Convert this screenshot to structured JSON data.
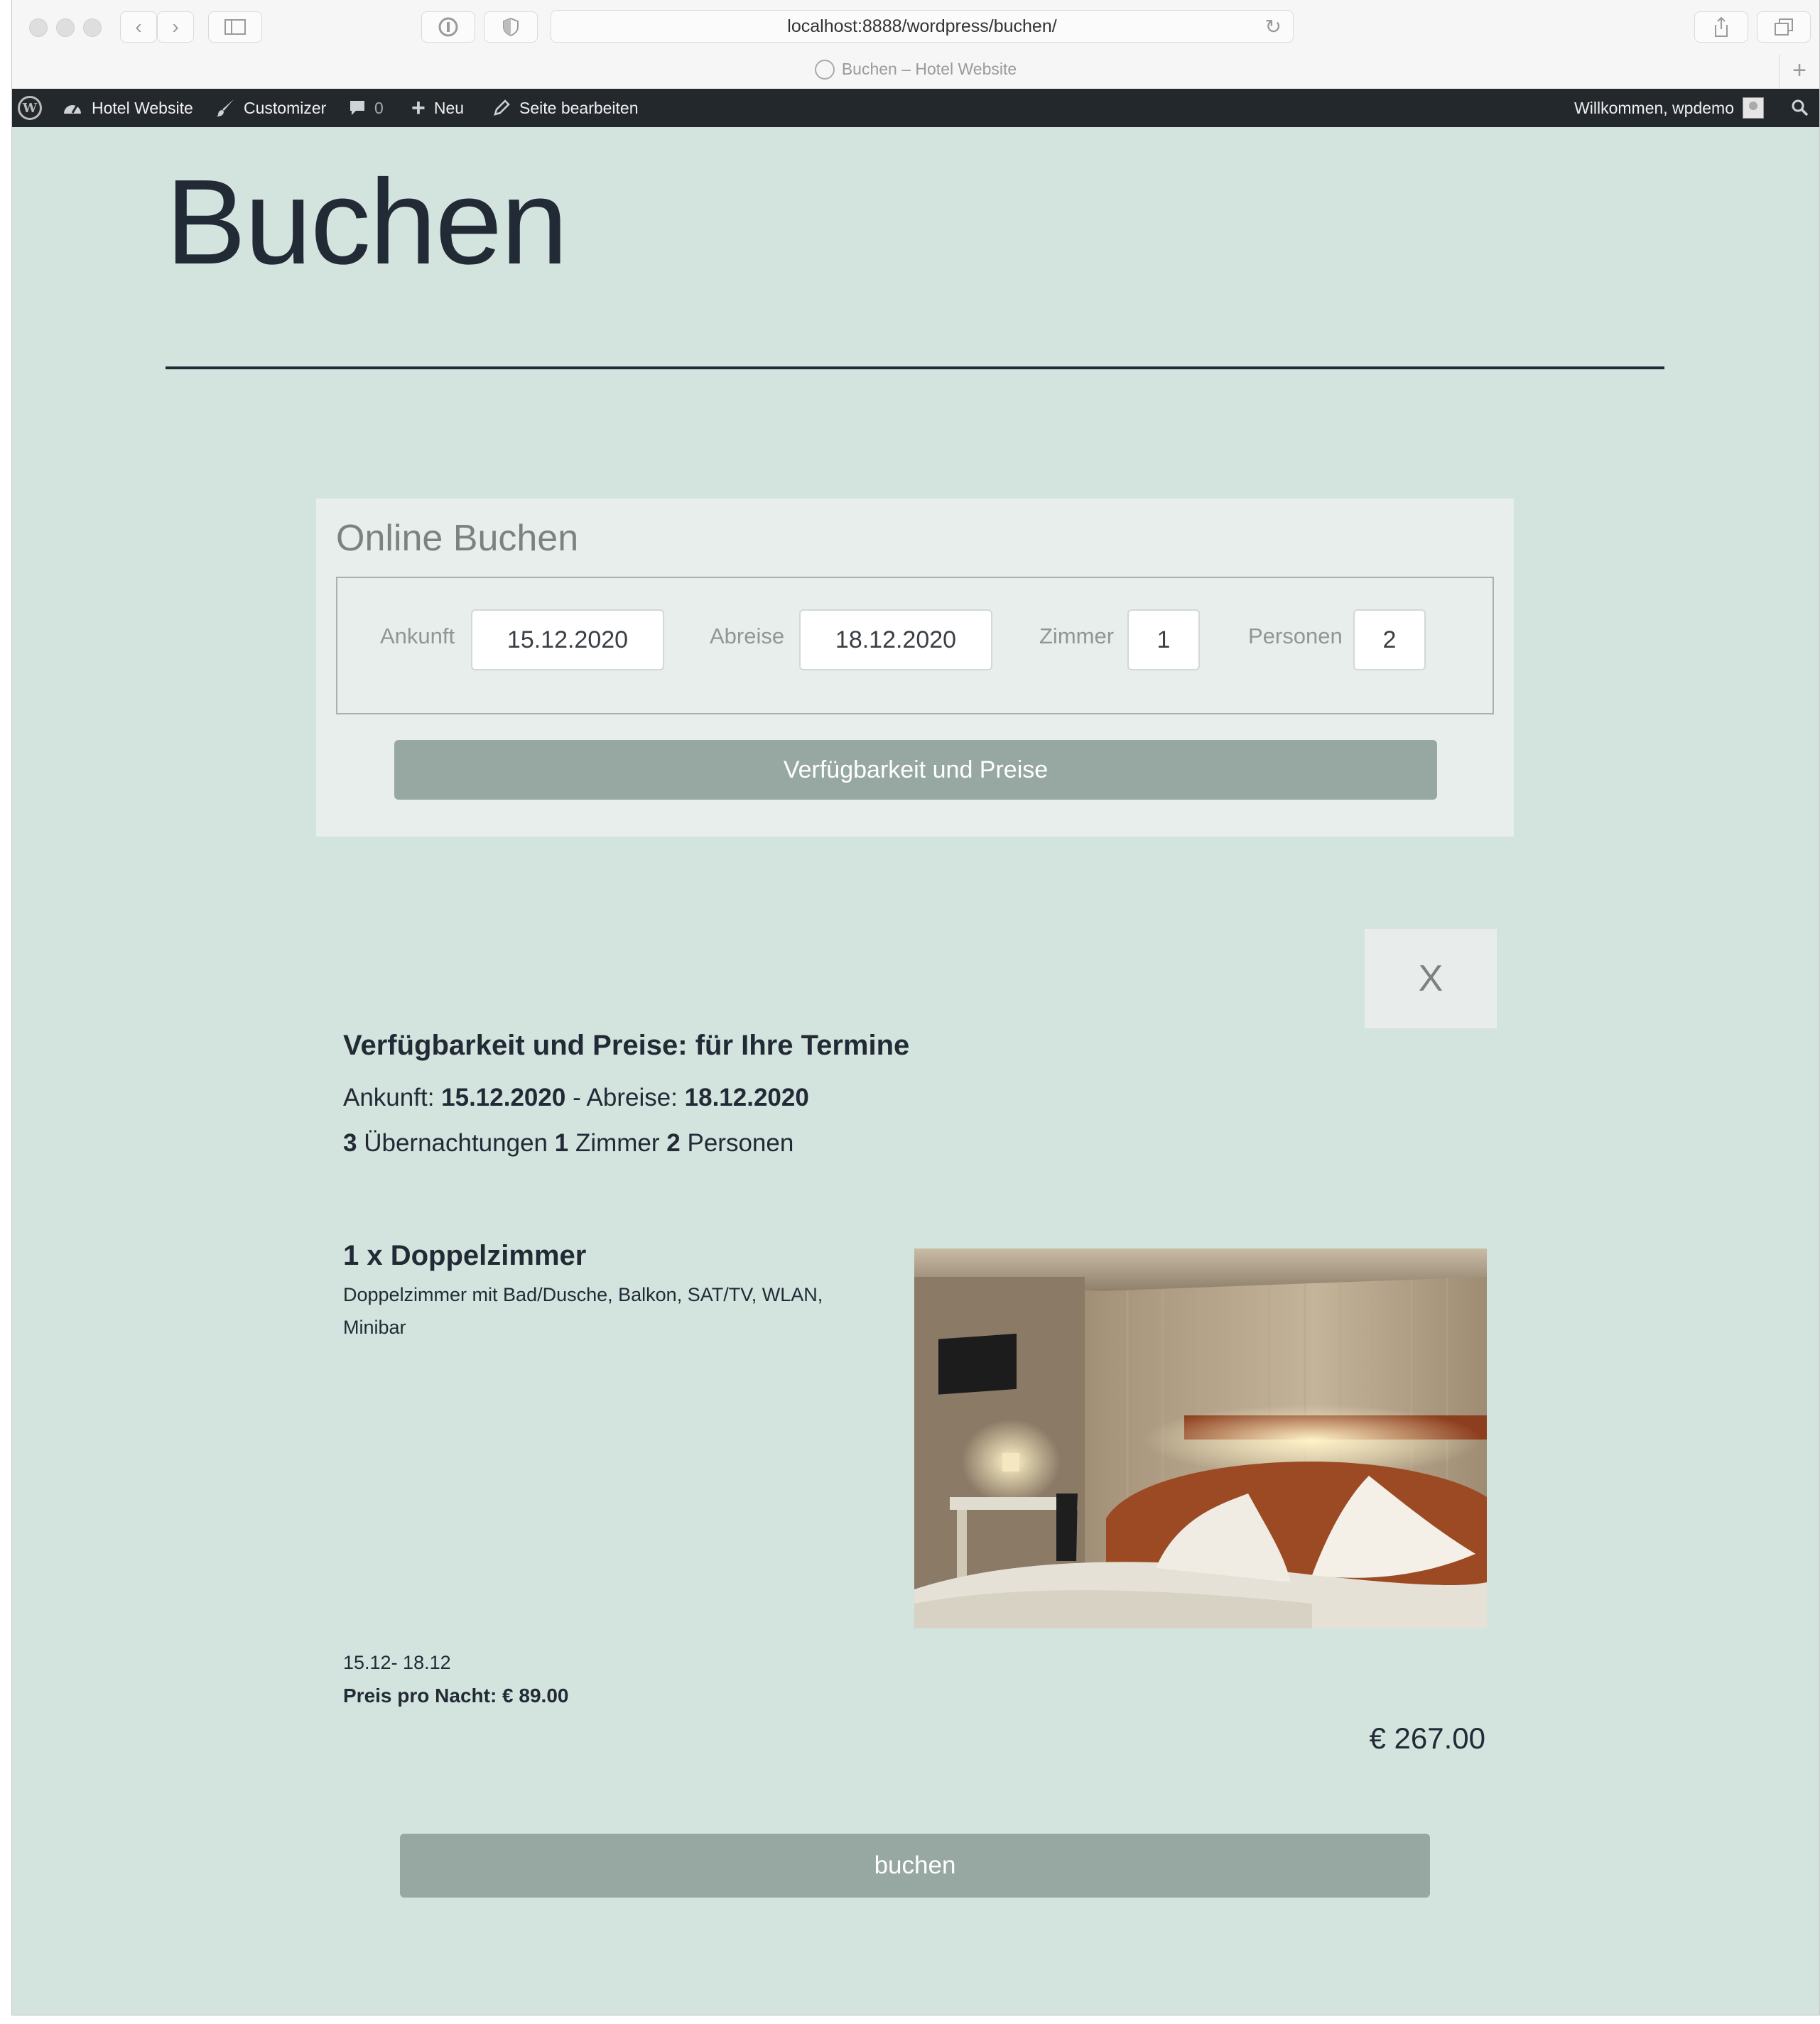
{
  "browser": {
    "url": "localhost:8888/wordpress/buchen/",
    "tab_title": "Buchen – Hotel Website"
  },
  "adminbar": {
    "site_name": "Hotel Website",
    "customizer": "Customizer",
    "comments_count": "0",
    "new": "Neu",
    "edit_page": "Seite bearbeiten",
    "welcome": "Willkommen, wpdemo"
  },
  "page": {
    "title": "Buchen"
  },
  "booking_form": {
    "heading": "Online Buchen",
    "arrival_label": "Ankunft",
    "arrival_value": "15.12.2020",
    "departure_label": "Abreise",
    "departure_value": "18.12.2020",
    "rooms_label": "Zimmer",
    "rooms_value": "1",
    "persons_label": "Personen",
    "persons_value": "2",
    "submit_label": "Verfügbarkeit und Preise"
  },
  "results": {
    "close_label": "X",
    "title": "Verfügbarkeit und Preise: für Ihre Termine",
    "arrival_label": "Ankunft:",
    "arrival_value": "15.12.2020",
    "separator": "- Abreise:",
    "departure_value": "18.12.2020",
    "nights_count": "3",
    "nights_label": "Übernachtungen",
    "rooms_count": "1",
    "rooms_label": "Zimmer",
    "persons_count": "2",
    "persons_label": "Personen"
  },
  "room": {
    "title": "1 x Doppelzimmer",
    "description": "Doppelzimmer mit Bad/Dusche, Balkon, SAT/TV, WLAN, Minibar",
    "dates": "15.12- 18.12",
    "price_per_night": "Preis pro Nacht: € 89.00",
    "total": "€ 267.00",
    "book_label": "buchen"
  },
  "colors": {
    "page_background": "#d3e4de",
    "button": "#97a8a2",
    "text_dark": "#222a36",
    "admin_bar": "#23282d"
  }
}
